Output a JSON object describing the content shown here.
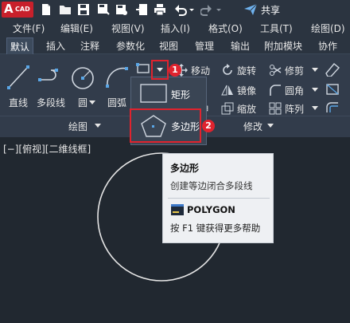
{
  "app": {
    "logo_letter": "A",
    "logo_text": "CAD",
    "share_label": "共享"
  },
  "menubar": {
    "items": [
      "文件(F)",
      "编辑(E)",
      "视图(V)",
      "插入(I)",
      "格式(O)",
      "工具(T)",
      "绘图(D)"
    ]
  },
  "ribbon": {
    "tabs": [
      "默认",
      "插入",
      "注释",
      "参数化",
      "视图",
      "管理",
      "输出",
      "附加模块",
      "协作"
    ],
    "active_tab": "默认",
    "draw": {
      "line": "直线",
      "polyline": "多段线",
      "circle": "圆",
      "arc": "圆弧",
      "panel_title": "绘图"
    },
    "modify": {
      "move": "移动",
      "rotate": "旋转",
      "trim": "修剪",
      "copy": "制",
      "mirror": "镜像",
      "fillet": "圆角",
      "stretch": "伸",
      "scale": "缩放",
      "array": "阵列",
      "panel_title": "修改"
    }
  },
  "flyout": {
    "rectangle": "矩形",
    "polygon": "多边形"
  },
  "callouts": {
    "badge1": "1",
    "badge2": "2"
  },
  "viewport": {
    "label": "[−][俯视][二维线框]"
  },
  "tooltip": {
    "title": "多边形",
    "description": "创建等边闭合多段线",
    "command": "POLYGON",
    "help": "按 F1 键获得更多帮助"
  },
  "colors": {
    "accent_red": "#e0232e",
    "canvas": "#212830",
    "ribbon": "#323c4b",
    "icon_blue": "#5aa6e6"
  }
}
